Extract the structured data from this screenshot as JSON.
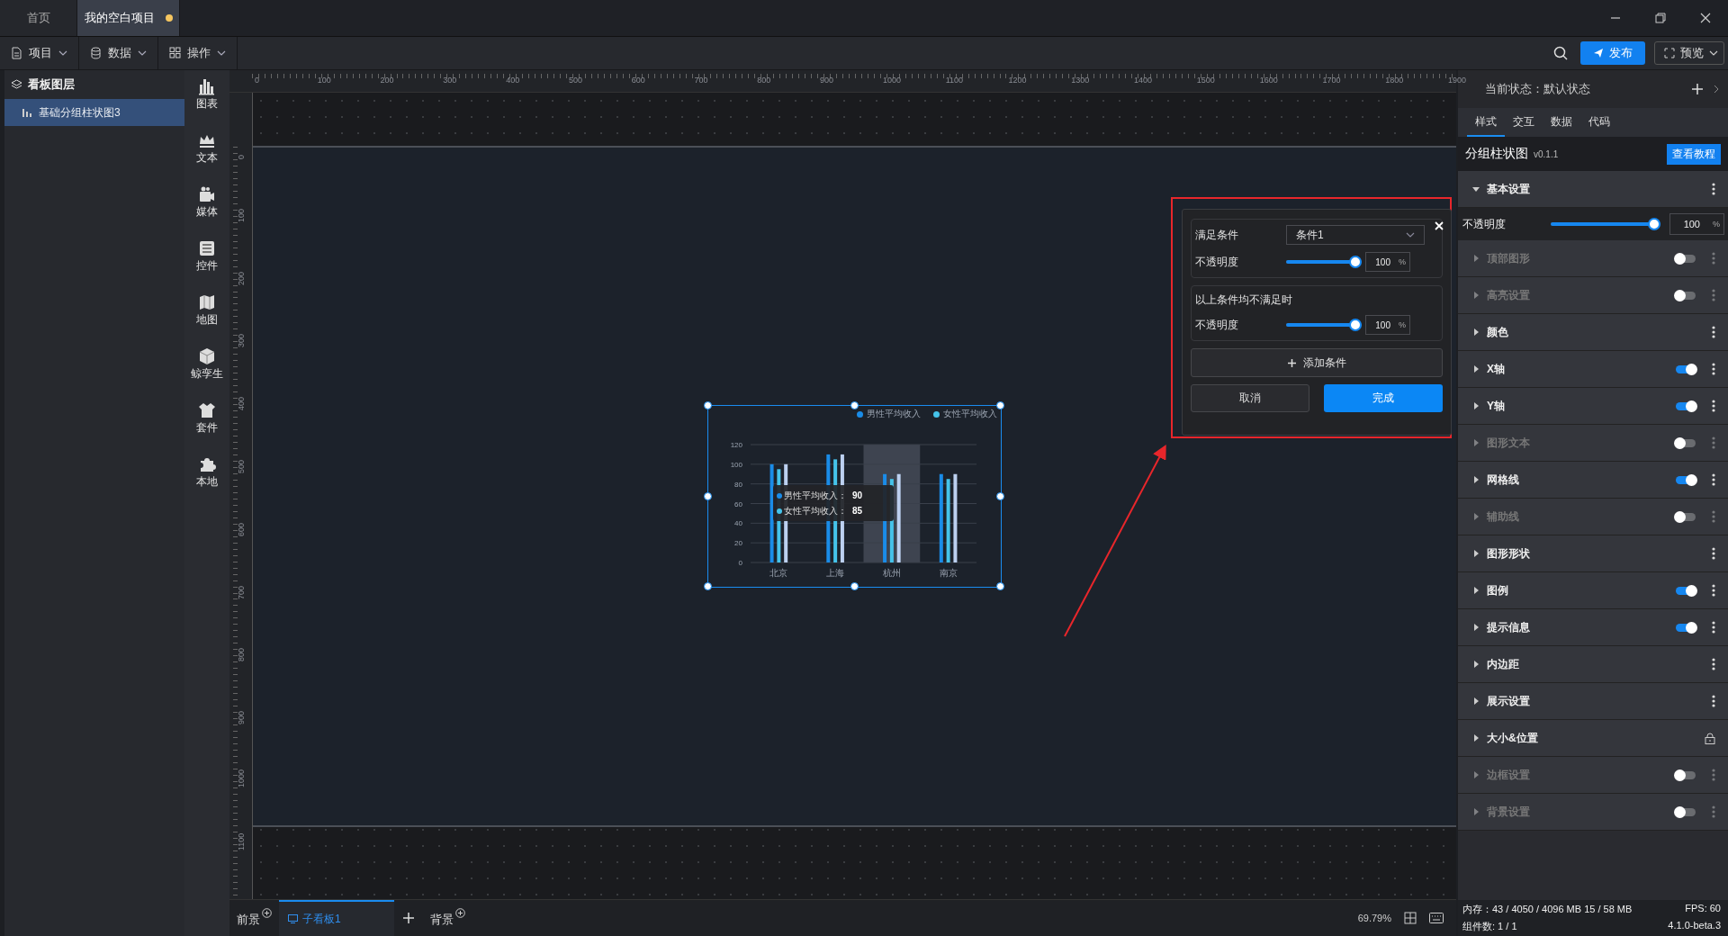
{
  "tabs": [
    {
      "label": "首页",
      "selected": false,
      "modified": false
    },
    {
      "label": "我的空白项目",
      "selected": true,
      "modified": true
    }
  ],
  "menus": [
    {
      "label": "项目",
      "kind": "file"
    },
    {
      "label": "数据",
      "kind": "database"
    },
    {
      "label": "操作",
      "kind": "grid"
    }
  ],
  "toolbar": {
    "publish": "发布",
    "preview": "预览"
  },
  "layers": {
    "title": "看板图层",
    "items": [
      {
        "label": "基础分组柱状图3",
        "selected": true
      }
    ]
  },
  "components": [
    {
      "label": "图表",
      "kind": "chart"
    },
    {
      "label": "文本",
      "kind": "text"
    },
    {
      "label": "媒体",
      "kind": "media"
    },
    {
      "label": "控件",
      "kind": "control"
    },
    {
      "label": "地图",
      "kind": "map"
    },
    {
      "label": "鲸孪生",
      "kind": "cube"
    },
    {
      "label": "套件",
      "kind": "suite"
    },
    {
      "label": "本地",
      "kind": "local"
    }
  ],
  "rulers": {
    "horizontal": [
      "0",
      "100",
      "200",
      "300",
      "400",
      "500",
      "600",
      "700",
      "800",
      "900",
      "1000",
      "1100",
      "1200",
      "1300",
      "1400",
      "1500",
      "1600",
      "1700",
      "1800",
      "1900"
    ],
    "vertical": [
      "0",
      "100",
      "200",
      "300",
      "400",
      "500",
      "600",
      "700",
      "800",
      "900",
      "1000",
      "1100"
    ]
  },
  "chart": {
    "selected": true,
    "chart_data": {
      "type": "bar",
      "grid": true,
      "legend": true,
      "bands": [
        {
          "axis": "x",
          "from": "杭州",
          "to": "杭州",
          "color": "#3e4450"
        }
      ],
      "categories": [
        "北京",
        "上海",
        "杭州",
        "南京"
      ],
      "series": [
        {
          "name": "男性平均收入",
          "color": "#1a8ce8",
          "values": [
            100,
            110,
            90,
            90
          ]
        },
        {
          "name": "女性平均收入",
          "color": "#45c3ea",
          "values": [
            95,
            105,
            85,
            85
          ]
        },
        {
          "color": "#bcd0f0",
          "values": [
            100,
            110,
            90,
            90
          ]
        }
      ],
      "ylim": [
        0,
        120
      ],
      "yticks": [
        0,
        20,
        40,
        60,
        80,
        100,
        120
      ]
    },
    "tooltip": [
      {
        "label": "男性平均收入：",
        "value": "90",
        "color": "#1a8ce8"
      },
      {
        "label": "女性平均收入：",
        "value": "85",
        "color": "#45c3ea"
      }
    ]
  },
  "condition_popup": {
    "condition_label": "满足条件",
    "condition_value": "条件1",
    "opacity": {
      "label": "不透明度",
      "level": 1,
      "value": "100",
      "unit": "%"
    },
    "fallback_title": "以上条件均不满足时",
    "fallback_opacity": {
      "label": "不透明度",
      "level": 1,
      "value": "100",
      "unit": "%"
    },
    "add_button": "添加条件",
    "cancel_button": "取消",
    "confirm_button": "完成"
  },
  "bottom_bar": {
    "foreground": "前景",
    "boards": [
      {
        "label": "子看板1",
        "selected": true
      }
    ],
    "background": "背景",
    "zoom": "69.79%"
  },
  "properties": {
    "state_label": "当前状态：默认状态",
    "tabs": [
      {
        "label": "样式",
        "selected": true
      },
      {
        "label": "交互",
        "selected": false
      },
      {
        "label": "数据",
        "selected": false
      },
      {
        "label": "代码",
        "selected": false
      }
    ],
    "component_title": "分组柱状图",
    "version": "v0.1.1",
    "tutorial_button": "查看教程",
    "sections": [
      {
        "label": "基本设置",
        "kind": "menu",
        "expanded": true,
        "content": {
          "label": "不透明度",
          "level": 1,
          "value": "100",
          "unit": "%"
        }
      },
      {
        "label": "顶部图形",
        "kind": "toggle",
        "on": false,
        "expanded": false
      },
      {
        "label": "高亮设置",
        "kind": "toggle",
        "on": false,
        "expanded": false
      },
      {
        "label": "颜色",
        "kind": "menu",
        "expanded": false
      },
      {
        "label": "X轴",
        "kind": "toggle",
        "on": true,
        "expanded": false
      },
      {
        "label": "Y轴",
        "kind": "toggle",
        "on": true,
        "expanded": false
      },
      {
        "label": "图形文本",
        "kind": "toggle",
        "on": false,
        "expanded": false
      },
      {
        "label": "网格线",
        "kind": "toggle",
        "on": true,
        "expanded": false
      },
      {
        "label": "辅助线",
        "kind": "toggle",
        "on": false,
        "expanded": false
      },
      {
        "label": "图形形状",
        "kind": "menu",
        "expanded": false
      },
      {
        "label": "图例",
        "kind": "toggle",
        "on": true,
        "expanded": false
      },
      {
        "label": "提示信息",
        "kind": "toggle",
        "on": true,
        "expanded": false
      },
      {
        "label": "内边距",
        "kind": "menu",
        "expanded": false
      },
      {
        "label": "展示设置",
        "kind": "menu",
        "expanded": false
      },
      {
        "label": "大小&位置",
        "kind": "lock",
        "expanded": false
      },
      {
        "label": "边框设置",
        "kind": "toggle",
        "on": false,
        "expanded": false
      },
      {
        "label": "背景设置",
        "kind": "toggle",
        "on": false,
        "expanded": false
      }
    ]
  },
  "status": {
    "memory": "内存：43 / 4050 / 4096 MB 15 / 58 MB",
    "fps": "FPS: 60",
    "components": "组件数: 1 / 1",
    "version": "4.1.0-beta.3"
  }
}
